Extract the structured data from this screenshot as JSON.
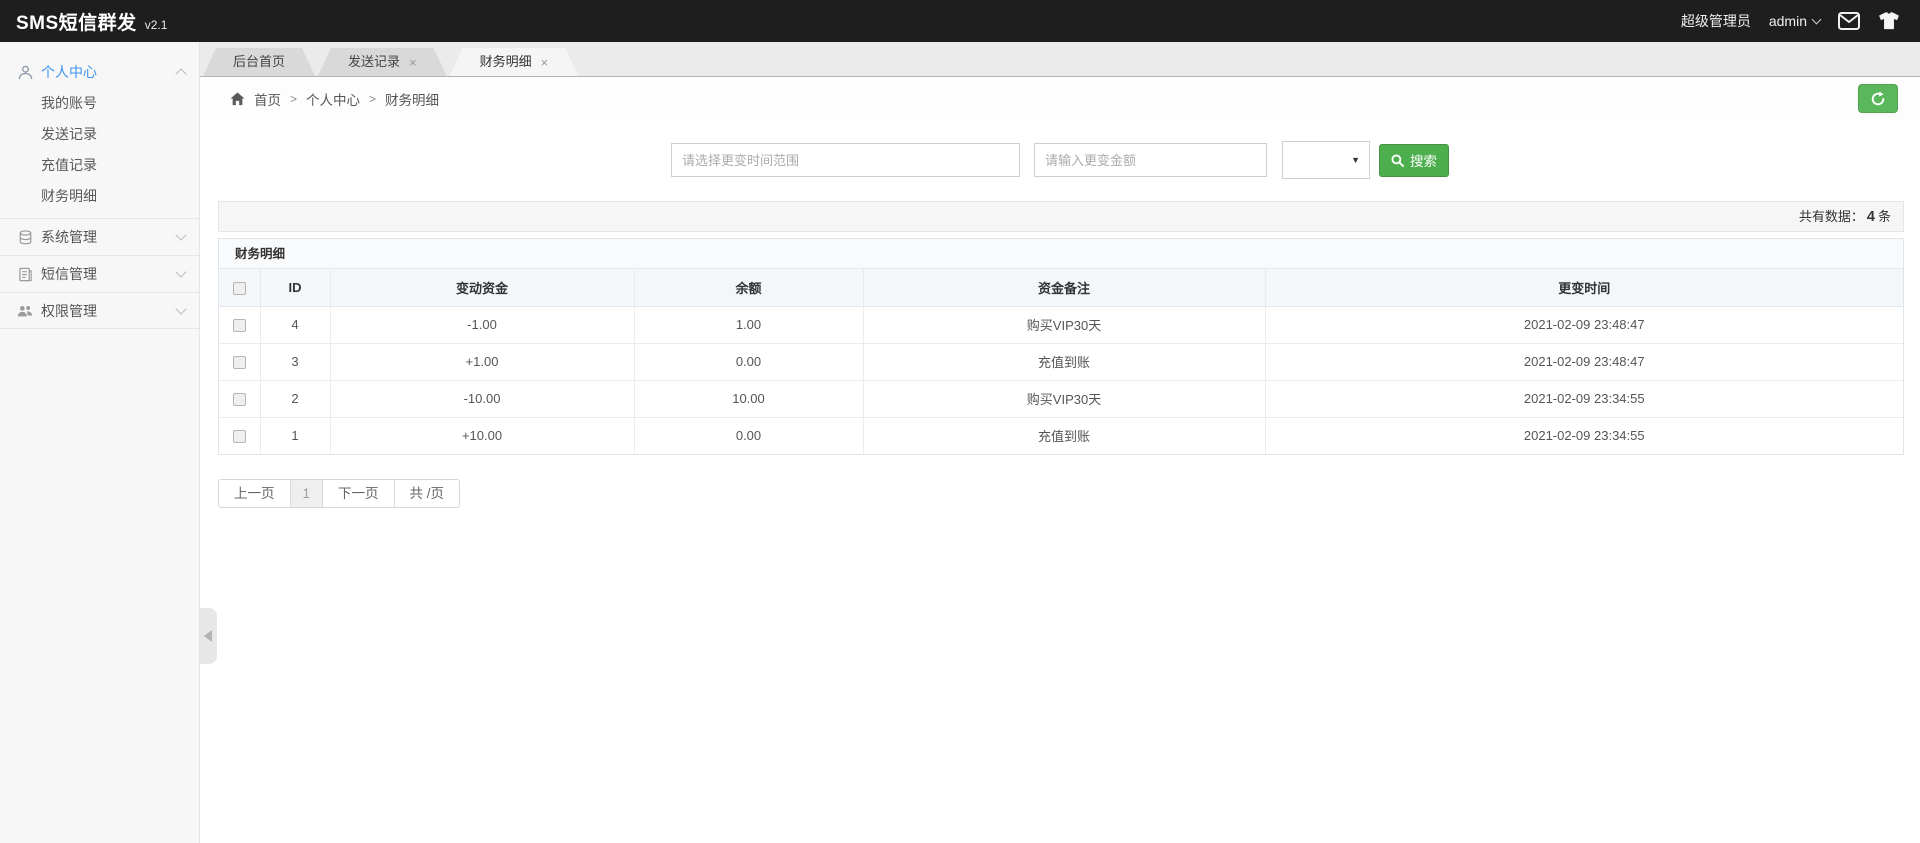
{
  "topbar": {
    "title": "SMS短信群发",
    "version": "v2.1",
    "role": "超级管理员",
    "username": "admin"
  },
  "sidebar": {
    "sections": [
      {
        "label": "个人中心",
        "children": [
          "我的账号",
          "发送记录",
          "充值记录",
          "财务明细"
        ]
      },
      {
        "label": "系统管理"
      },
      {
        "label": "短信管理"
      },
      {
        "label": "权限管理"
      }
    ]
  },
  "tabs": {
    "close_glyph": "×",
    "items": [
      {
        "label": "后台首页"
      },
      {
        "label": "发送记录"
      },
      {
        "label": "财务明细"
      }
    ]
  },
  "breadcrumb": {
    "separator": ">",
    "items": [
      "首页",
      "个人中心",
      "财务明细"
    ]
  },
  "search": {
    "time_placeholder": "请选择更变时间范围",
    "amount_placeholder": "请输入更变金额",
    "button_label": "搜索"
  },
  "stats": {
    "label": "共有数据：",
    "count": "4",
    "unit": "条"
  },
  "panel": {
    "title": "财务明细"
  },
  "table": {
    "headers": [
      "ID",
      "变动资金",
      "余额",
      "资金备注",
      "更变时间"
    ],
    "rows": [
      {
        "id": "4",
        "change": "-1.00",
        "balance": "1.00",
        "remark": "购买VIP30天",
        "time": "2021-02-09 23:48:47"
      },
      {
        "id": "3",
        "change": "+1.00",
        "balance": "0.00",
        "remark": "充值到账",
        "time": "2021-02-09 23:48:47"
      },
      {
        "id": "2",
        "change": "-10.00",
        "balance": "10.00",
        "remark": "购买VIP30天",
        "time": "2021-02-09 23:34:55"
      },
      {
        "id": "1",
        "change": "+10.00",
        "balance": "0.00",
        "remark": "充值到账",
        "time": "2021-02-09 23:34:55"
      }
    ]
  },
  "pagination": {
    "prev": "上一页",
    "page": "1",
    "next": "下一页",
    "total": "共 /页"
  },
  "colors": {
    "topbar_bg": "#1e1e1e",
    "active_blue": "#3d95ee",
    "button_green": "#4cae4c",
    "refresh_green": "#5bb75b"
  }
}
